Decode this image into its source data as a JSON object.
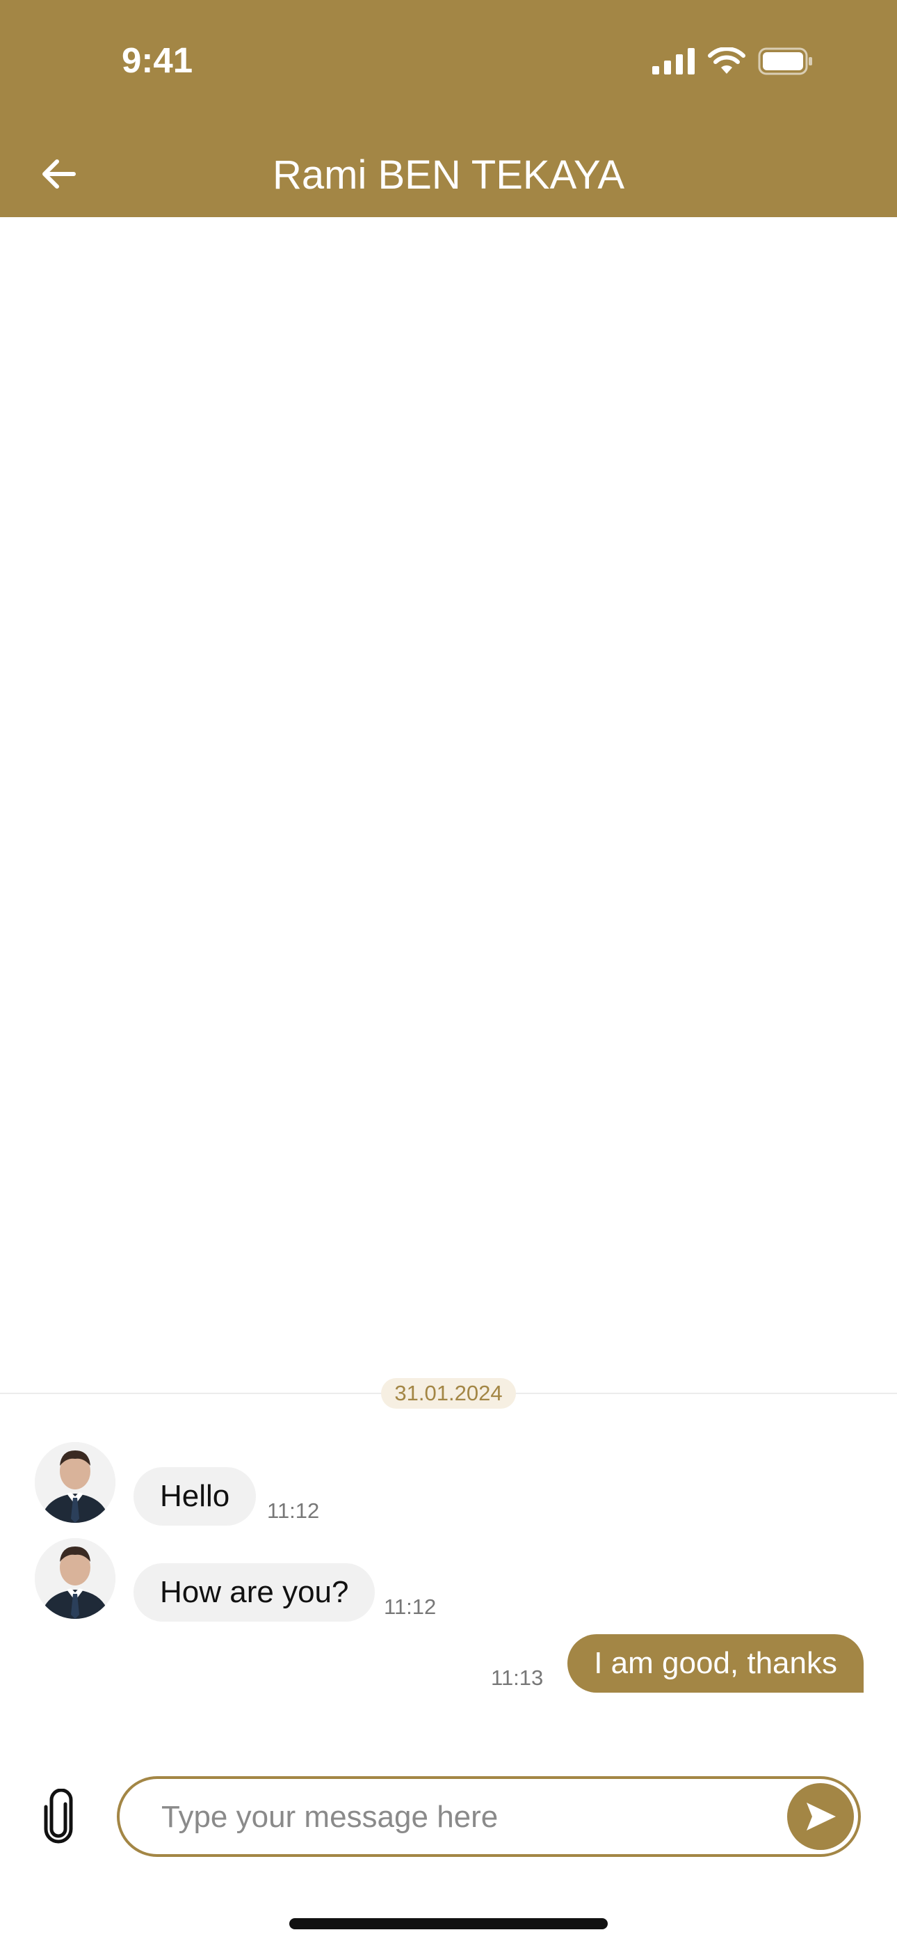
{
  "status_bar": {
    "time": "9:41"
  },
  "header": {
    "title": "Rami BEN TEKAYA"
  },
  "chat": {
    "date": "31.01.2024",
    "messages": [
      {
        "direction": "incoming",
        "text": "Hello",
        "time": "11:12"
      },
      {
        "direction": "incoming",
        "text": "How are you?",
        "time": "11:12"
      },
      {
        "direction": "outgoing",
        "text": "I am good, thanks",
        "time": "11:13"
      }
    ]
  },
  "composer": {
    "placeholder": "Type your message here",
    "value": ""
  },
  "colors": {
    "accent": "#a38645",
    "incoming_bubble": "#f1f1f1",
    "date_chip_bg": "#f6efe2"
  },
  "icons": [
    "back-arrow-icon",
    "paperclip-icon",
    "send-icon",
    "signal-icon",
    "wifi-icon",
    "battery-icon"
  ]
}
